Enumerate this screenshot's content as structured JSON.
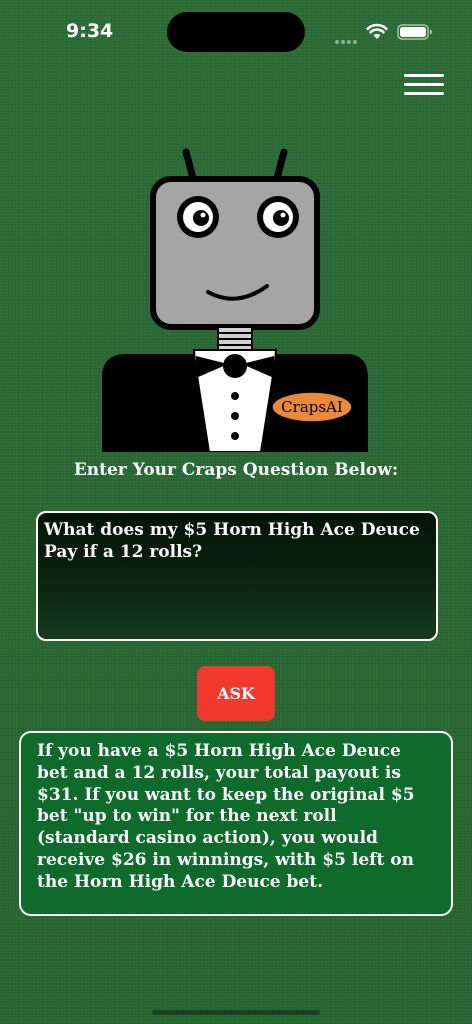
{
  "status_bar": {
    "time": "9:34",
    "icons": [
      "signal-icon",
      "wifi-icon",
      "battery-icon"
    ]
  },
  "header": {
    "menu_icon": "hamburger-menu-icon"
  },
  "logo": {
    "badge_text": "CrapsAI",
    "badge_color": "#e88a3a"
  },
  "prompt": {
    "label": "Enter Your Craps Question Below:"
  },
  "question": {
    "value": "What does my $5 Horn High Ace Deuce Pay if a 12 rolls?"
  },
  "ask_button": {
    "label": "ASK",
    "color": "#f1392e"
  },
  "answer": {
    "text": "If you have a $5 Horn High Ace Deuce bet and a 12 rolls, your total payout is $31. If you want to keep the original $5 bet \"up to win\" for the next roll (standard casino action), you would receive $26 in winnings, with $5 left on the Horn High Ace Deuce bet.",
    "background": "#0e6b2b"
  },
  "theme": {
    "felt_color": "#2a6b34"
  }
}
